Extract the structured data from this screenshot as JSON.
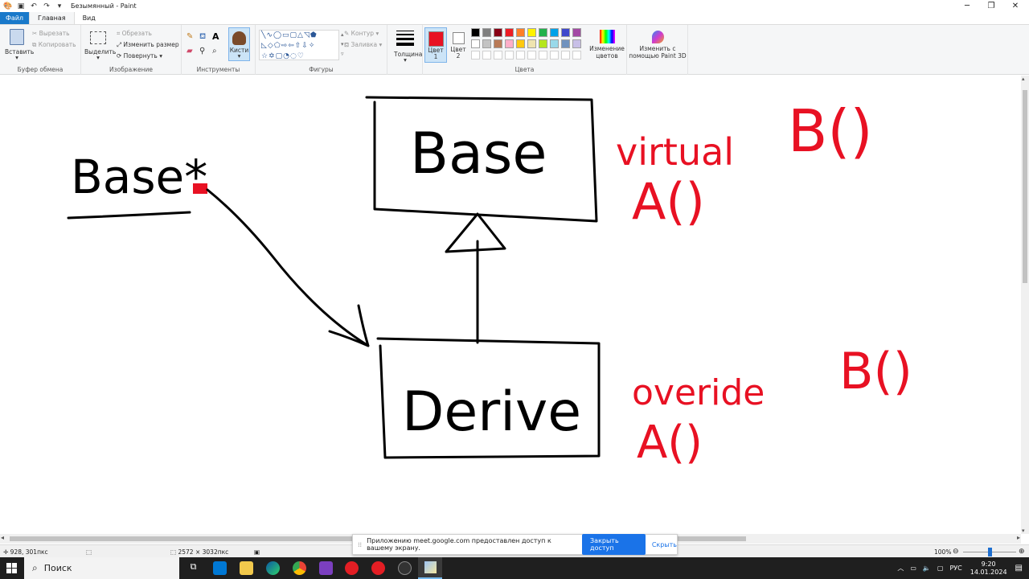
{
  "window": {
    "title": "Безымянный - Paint"
  },
  "tabs": [
    {
      "label": "Файл"
    },
    {
      "label": "Главная"
    },
    {
      "label": "Вид"
    }
  ],
  "ribbon": {
    "clipboard": {
      "paste": "Вставить",
      "cut": "Вырезать",
      "copy": "Копировать",
      "group": "Буфер обмена"
    },
    "image": {
      "select": "Выделить",
      "crop": "Обрезать",
      "resize": "Изменить размер",
      "rotate": "Повернуть",
      "group": "Изображение"
    },
    "tools": {
      "group": "Инструменты",
      "brushes": "Кисти"
    },
    "shapes": {
      "outline": "Контур",
      "fill": "Заливка",
      "group": "Фигуры"
    },
    "thickness": "Толщина",
    "color1": {
      "label": "Цвет",
      "num": "1"
    },
    "color2": {
      "label": "Цвет",
      "num": "2"
    },
    "colors_group": "Цвета",
    "edit_colors": {
      "line1": "Изменение",
      "line2": "цветов"
    },
    "paint3d": {
      "line1": "Изменить с",
      "line2": "помощью Paint 3D"
    }
  },
  "palette": {
    "row1": [
      "#000000",
      "#7f7f7f",
      "#880015",
      "#ed1c24",
      "#ff7f27",
      "#fff200",
      "#22b14c",
      "#00a2e8",
      "#3f48cc",
      "#a349a4"
    ],
    "row2": [
      "#ffffff",
      "#c3c3c3",
      "#b97a57",
      "#ffaec9",
      "#ffc90e",
      "#efe4b0",
      "#b5e61d",
      "#99d9ea",
      "#7092be",
      "#c8bfe7"
    ],
    "color1": "#e81123",
    "color2": "#ffffff"
  },
  "drawing": {
    "black_texts": [
      {
        "text": "Base*"
      },
      {
        "text": "Base"
      },
      {
        "text": "Derive"
      }
    ],
    "red_texts": [
      {
        "text": "virtual"
      },
      {
        "text": "B()"
      },
      {
        "text": "A()"
      },
      {
        "text": "overide"
      },
      {
        "text": "B()"
      },
      {
        "text": "A()"
      }
    ],
    "ink_black": "#000000",
    "ink_red": "#e81123"
  },
  "status": {
    "cursor": "928, 301пкс",
    "size": "2572 × 3032пкс",
    "zoom": "100%"
  },
  "share_banner": {
    "text": "Приложению meet.google.com предоставлен доступ к вашему экрану.",
    "stop": "Закрыть доступ",
    "hide": "Скрыть"
  },
  "taskbar": {
    "search": "Поиск",
    "lang": "РУС",
    "time": "9:20",
    "date": "14.01.2024"
  }
}
